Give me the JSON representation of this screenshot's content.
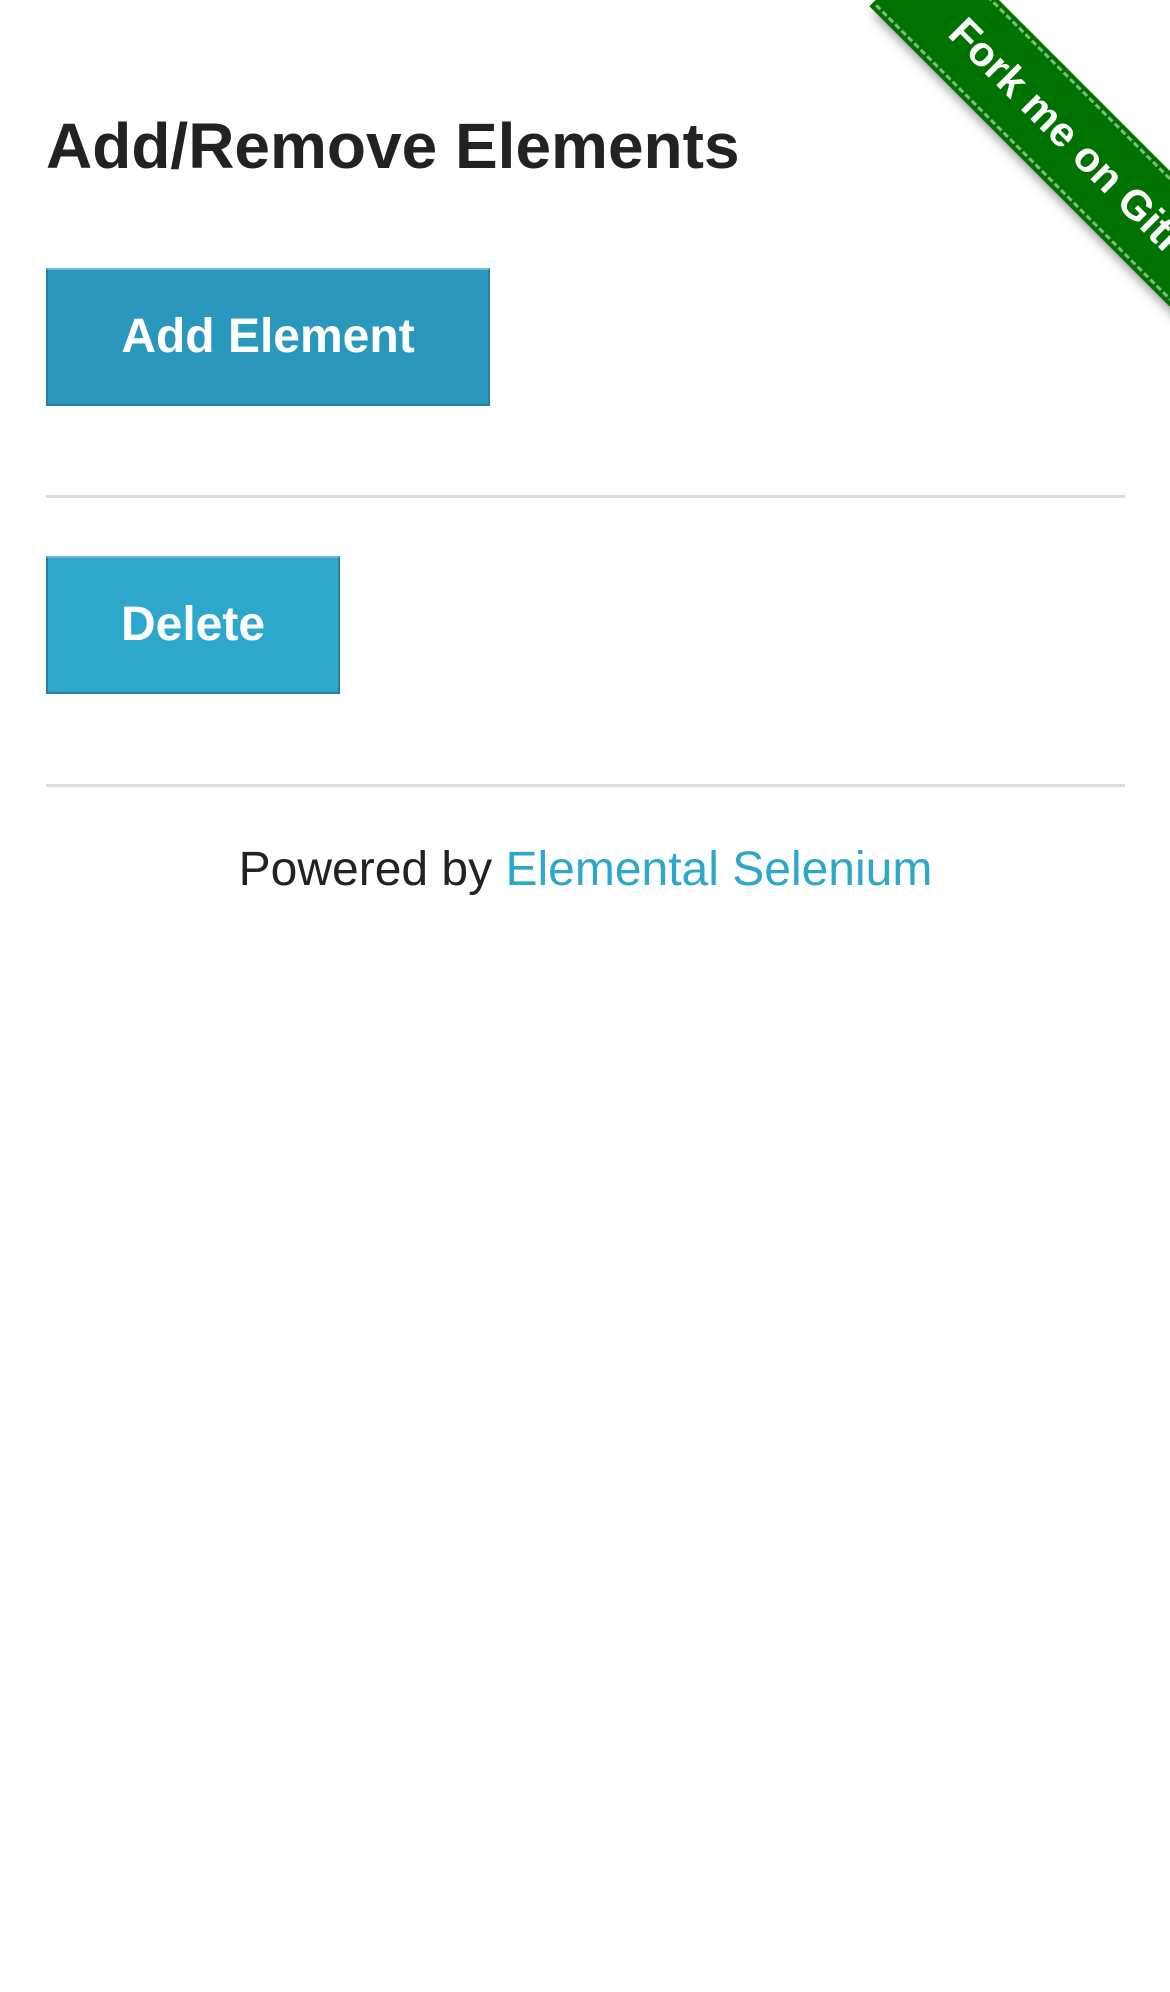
{
  "page": {
    "title": "Add/Remove Elements"
  },
  "buttons": {
    "add_label": "Add Element",
    "delete_label": "Delete"
  },
  "footer": {
    "prefix": "Powered by ",
    "link_text": "Elemental Selenium"
  },
  "ribbon": {
    "text": "Fork me on GitHub"
  },
  "colors": {
    "add_button": "#2a98bc",
    "delete_button": "#2da7cc",
    "link": "#2da7cc",
    "ribbon": "#007200",
    "divider": "#dcdcdc",
    "text": "#222222"
  }
}
